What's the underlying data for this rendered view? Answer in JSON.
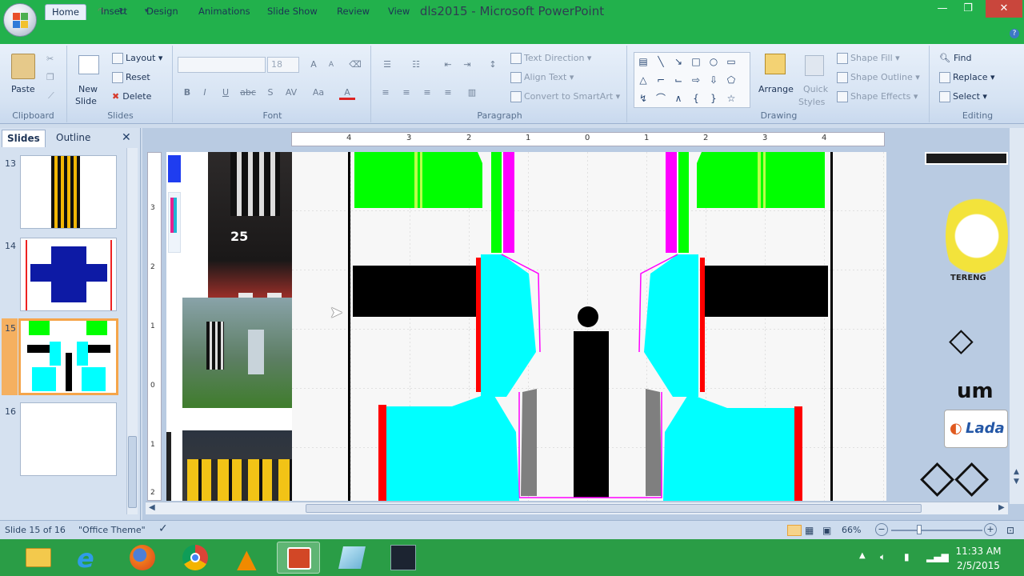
{
  "window": {
    "title": "dls2015 - Microsoft PowerPoint"
  },
  "tabs": [
    "Home",
    "Insert",
    "Design",
    "Animations",
    "Slide Show",
    "Review",
    "View"
  ],
  "ribbon": {
    "clipboard": {
      "label": "Clipboard",
      "paste": "Paste"
    },
    "slides": {
      "label": "Slides",
      "new_slide": "New",
      "new_slide2": "Slide",
      "layout": "Layout",
      "reset": "Reset",
      "delete": "Delete"
    },
    "font": {
      "label": "Font",
      "size": "18",
      "bold": "B",
      "italic": "I",
      "underline": "U",
      "strike": "abc",
      "shadow": "S",
      "spacing": "AV",
      "case": "Aa",
      "color": "A",
      "grow": "A",
      "shrink": "A"
    },
    "paragraph": {
      "label": "Paragraph",
      "text_direction": "Text Direction",
      "align_text": "Align Text",
      "convert": "Convert to SmartArt"
    },
    "drawing": {
      "label": "Drawing",
      "arrange": "Arrange",
      "quick_styles": "Quick",
      "quick_styles2": "Styles",
      "shape_fill": "Shape Fill",
      "shape_outline": "Shape Outline",
      "shape_effects": "Shape Effects"
    },
    "editing": {
      "label": "Editing",
      "find": "Find",
      "replace": "Replace",
      "select": "Select"
    }
  },
  "panel": {
    "tab_slides": "Slides",
    "tab_outline": "Outline",
    "close": "✕"
  },
  "thumbnails": [
    {
      "num": "13"
    },
    {
      "num": "14"
    },
    {
      "num": "15"
    },
    {
      "num": "16"
    }
  ],
  "ruler": {
    "h": [
      "4",
      "3",
      "2",
      "1",
      "0",
      "1",
      "2",
      "3",
      "4"
    ],
    "v": [
      "3",
      "2",
      "1",
      "0",
      "1",
      "2"
    ]
  },
  "slide_images": {
    "jersey_number": "25",
    "logo_brand": "um",
    "logo_lada": "Lada",
    "logo_crest": "TERENG"
  },
  "status": {
    "slide": "Slide 15 of 16",
    "theme": "\"Office Theme\"",
    "zoom": "66%"
  },
  "tray": {
    "time": "11:33 AM",
    "date": "2/5/2015"
  },
  "colors": {
    "titlebar": "#22b14c",
    "taskbar": "#2a9d46",
    "green": "#00ff00",
    "cyan": "#00ffff",
    "magenta": "#ff00ff",
    "red": "#ff0000"
  }
}
